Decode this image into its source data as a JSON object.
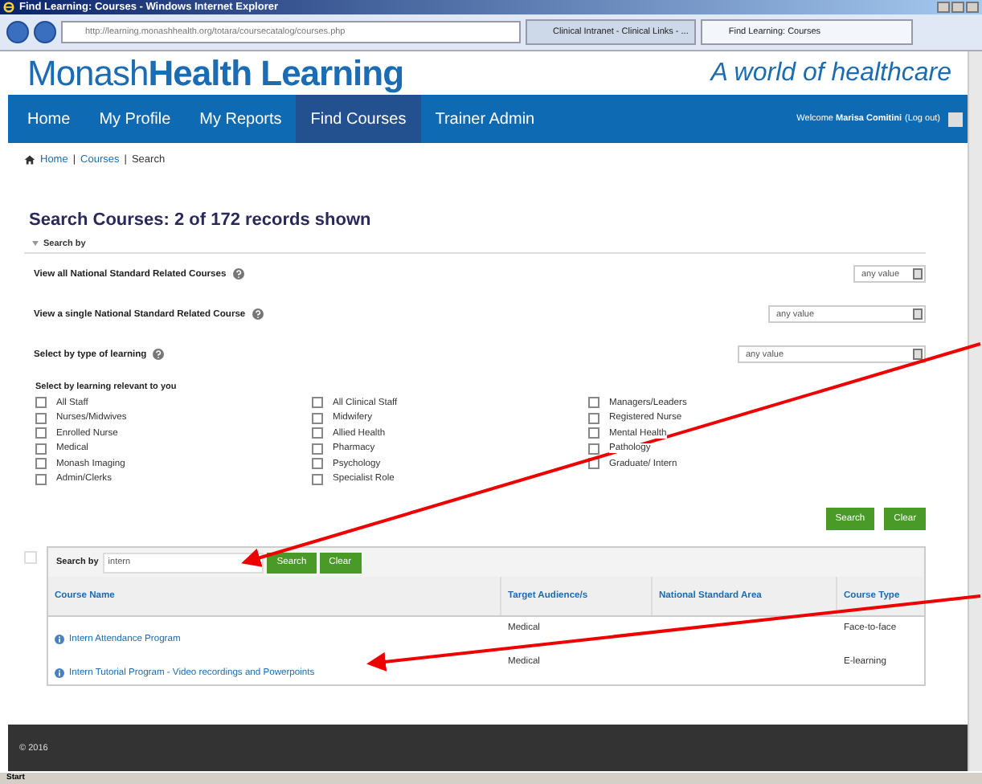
{
  "window": {
    "title": "Find Learning: Courses - Windows Internet Explorer"
  },
  "browser": {
    "url": "http://learning.monashhealth.org/totara/coursecatalog/courses.php",
    "tabs": [
      {
        "label": "Clinical Intranet - Clinical Links - ...",
        "selected": false
      },
      {
        "label": "Find Learning: Courses",
        "selected": true
      }
    ]
  },
  "site": {
    "logo_light": "Monash",
    "logo_bold": "Health Learning",
    "tagline": "A world of healthcare"
  },
  "nav": {
    "items": [
      {
        "label": "Home",
        "selected": false
      },
      {
        "label": "My Profile",
        "selected": false
      },
      {
        "label": "My Reports",
        "selected": false
      },
      {
        "label": "Find Courses",
        "selected": true
      },
      {
        "label": "Trainer Admin",
        "selected": false
      }
    ],
    "welcome": "Welcome",
    "user": "Marisa Comitini",
    "logout": "(Log out)"
  },
  "breadcrumb": {
    "items": [
      "Home",
      "Courses",
      "Search"
    ],
    "separator": "|"
  },
  "heading": "Search Courses: 2 of 172 records shown",
  "search_by": {
    "label": "Search by",
    "expanded": true
  },
  "filters": [
    {
      "label": "View all National Standard Related Courses",
      "value": "any value"
    },
    {
      "label": "View a single National Standard Related Course",
      "value": "any value"
    },
    {
      "label": "Select by type of learning",
      "value": "any value"
    }
  ],
  "learning": {
    "label": "Select by learning relevant to you",
    "columns": [
      [
        {
          "label": "All Staff",
          "checked": false
        },
        {
          "label": "Nurses/Midwives",
          "checked": false
        },
        {
          "label": "Enrolled Nurse",
          "checked": false
        },
        {
          "label": "Medical",
          "checked": false
        },
        {
          "label": "Monash Imaging",
          "checked": false
        },
        {
          "label": "Admin/Clerks",
          "checked": false
        }
      ],
      [
        {
          "label": "All Clinical Staff",
          "checked": false
        },
        {
          "label": "Midwifery",
          "checked": false
        },
        {
          "label": "Allied Health",
          "checked": false
        },
        {
          "label": "Pharmacy",
          "checked": false
        },
        {
          "label": "Psychology",
          "checked": false
        },
        {
          "label": "Specialist Role",
          "checked": false
        }
      ],
      [
        {
          "label": "Managers/Leaders",
          "checked": false
        },
        {
          "label": "Registered Nurse",
          "checked": false
        },
        {
          "label": "Mental Health",
          "checked": false
        },
        {
          "label": "Pathology",
          "checked": false
        },
        {
          "label": "Graduate/ Intern",
          "checked": false
        }
      ]
    ]
  },
  "buttons": [
    "Search",
    "Clear"
  ],
  "results": {
    "select_all": {
      "checked": false
    },
    "search_label": "Search by",
    "query": "intern",
    "buttons": [
      "Search",
      "Clear"
    ],
    "columns": [
      "Course Name",
      "Target Audience/s",
      "National Standard Area",
      "Course Type"
    ],
    "rows": [
      {
        "name": "Intern Attendance Program",
        "audience": "Medical",
        "type": "Face-to-face"
      },
      {
        "name": "Intern Tutorial Program - Video recordings and Powerpoints",
        "audience": "Medical",
        "type": "E-learning"
      }
    ]
  },
  "footer": "© 2016",
  "taskbar": {
    "start": "Start"
  }
}
